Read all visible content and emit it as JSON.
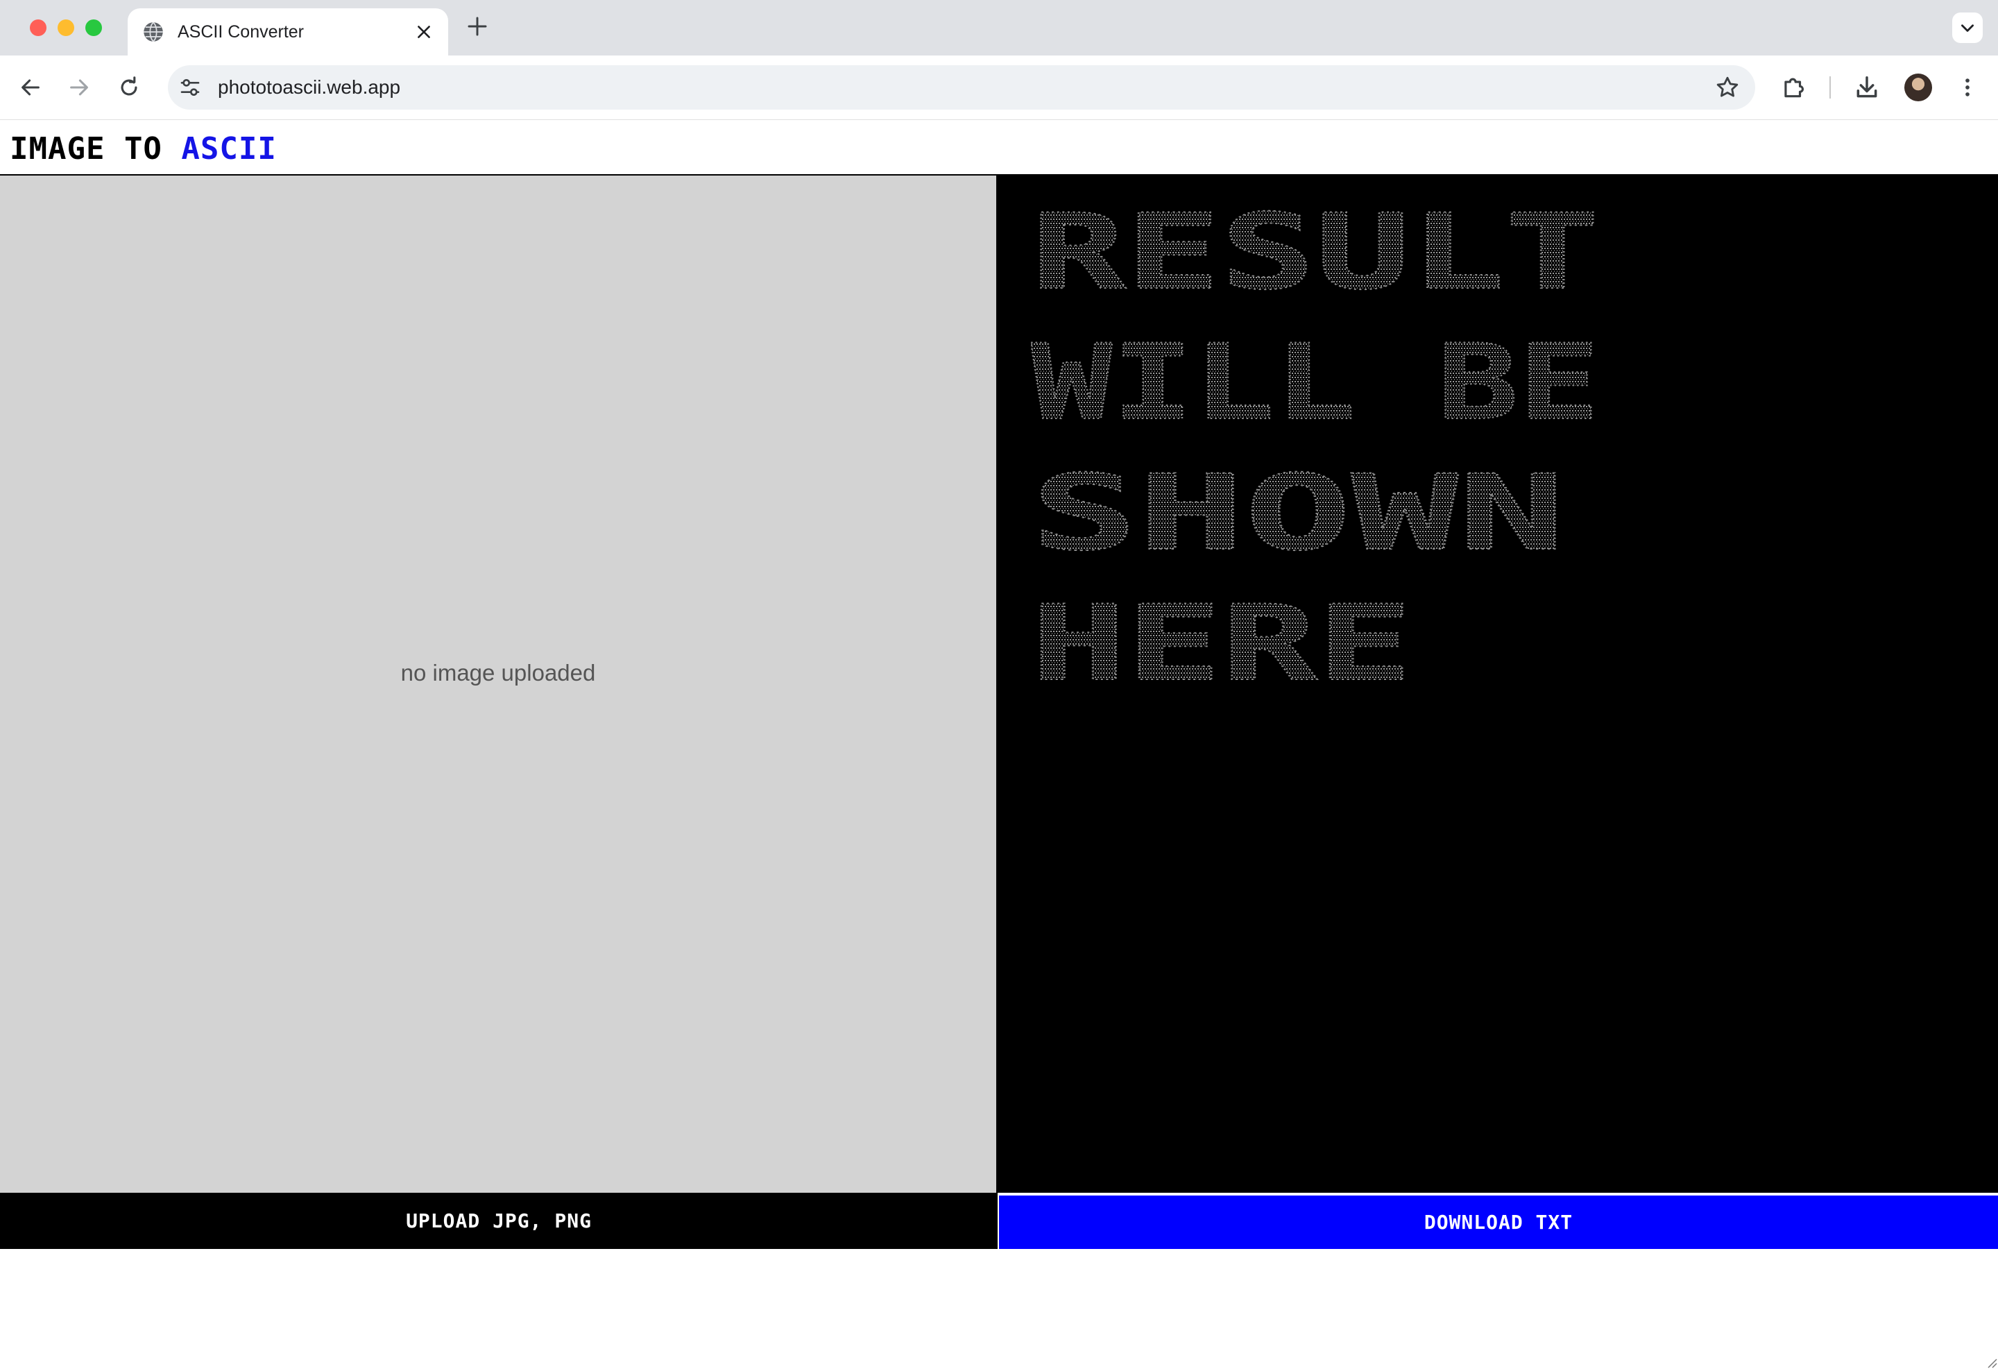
{
  "browser": {
    "tab_title": "ASCII Converter",
    "url": "phototoascii.web.app"
  },
  "app": {
    "title_prefix": "IMAGE TO ",
    "title_accent": "ASCII",
    "accent_color": "#1414e6",
    "placeholder": "no image uploaded",
    "ascii_preview_lines": [
      "RESULT",
      "WILL BE",
      "SHOWN",
      "HERE"
    ],
    "upload_label": "UPLOAD JPG, PNG",
    "download_label": "DOWNLOAD TXT",
    "download_color": "#0000ff"
  },
  "icons": {
    "tab_favicon": "globe-icon",
    "tab_close": "close-icon",
    "new_tab": "plus-icon",
    "tab_menu": "chevron-down-icon",
    "back": "arrow-left-icon",
    "forward": "arrow-right-icon",
    "reload": "reload-icon",
    "site_info": "tune-icon",
    "bookmark": "star-icon",
    "extensions": "puzzle-icon",
    "downloads": "download-icon",
    "profile": "avatar",
    "menu": "kebab-menu-icon"
  }
}
